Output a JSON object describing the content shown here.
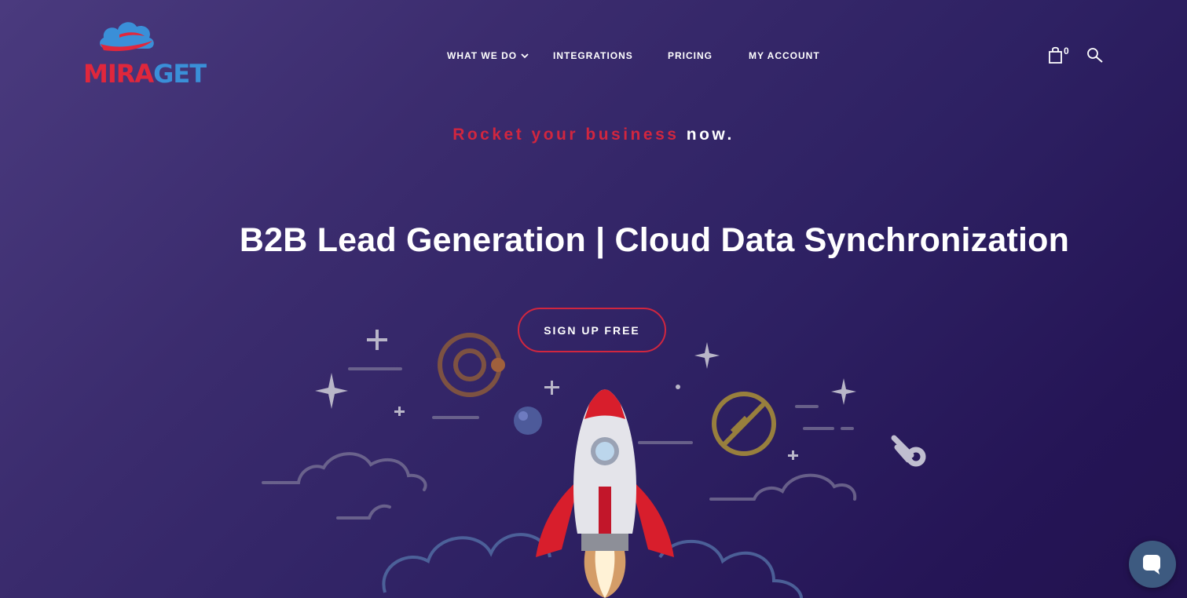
{
  "brand": {
    "name_part_red": "MIRA",
    "name_part_blue": "GET",
    "colors": {
      "red": "#e0273c",
      "blue": "#3a8fd8"
    }
  },
  "nav": {
    "items": [
      {
        "label": "WHAT WE DO",
        "has_dropdown": true
      },
      {
        "label": "INTEGRATIONS"
      },
      {
        "label": "PRICING"
      },
      {
        "label": "MY ACCOUNT"
      }
    ]
  },
  "cart": {
    "icon": "shopping-bag-icon",
    "count": "0"
  },
  "search": {
    "icon": "search-icon"
  },
  "hero": {
    "tagline_accent": "Rocket your business",
    "tagline_rest": " now.",
    "headline": "B2B Lead Generation | Cloud Data Synchronization",
    "cta_label": "SIGN UP FREE",
    "accent_color": "#d1263f"
  },
  "chat": {
    "icon": "chat-bubble-icon"
  }
}
